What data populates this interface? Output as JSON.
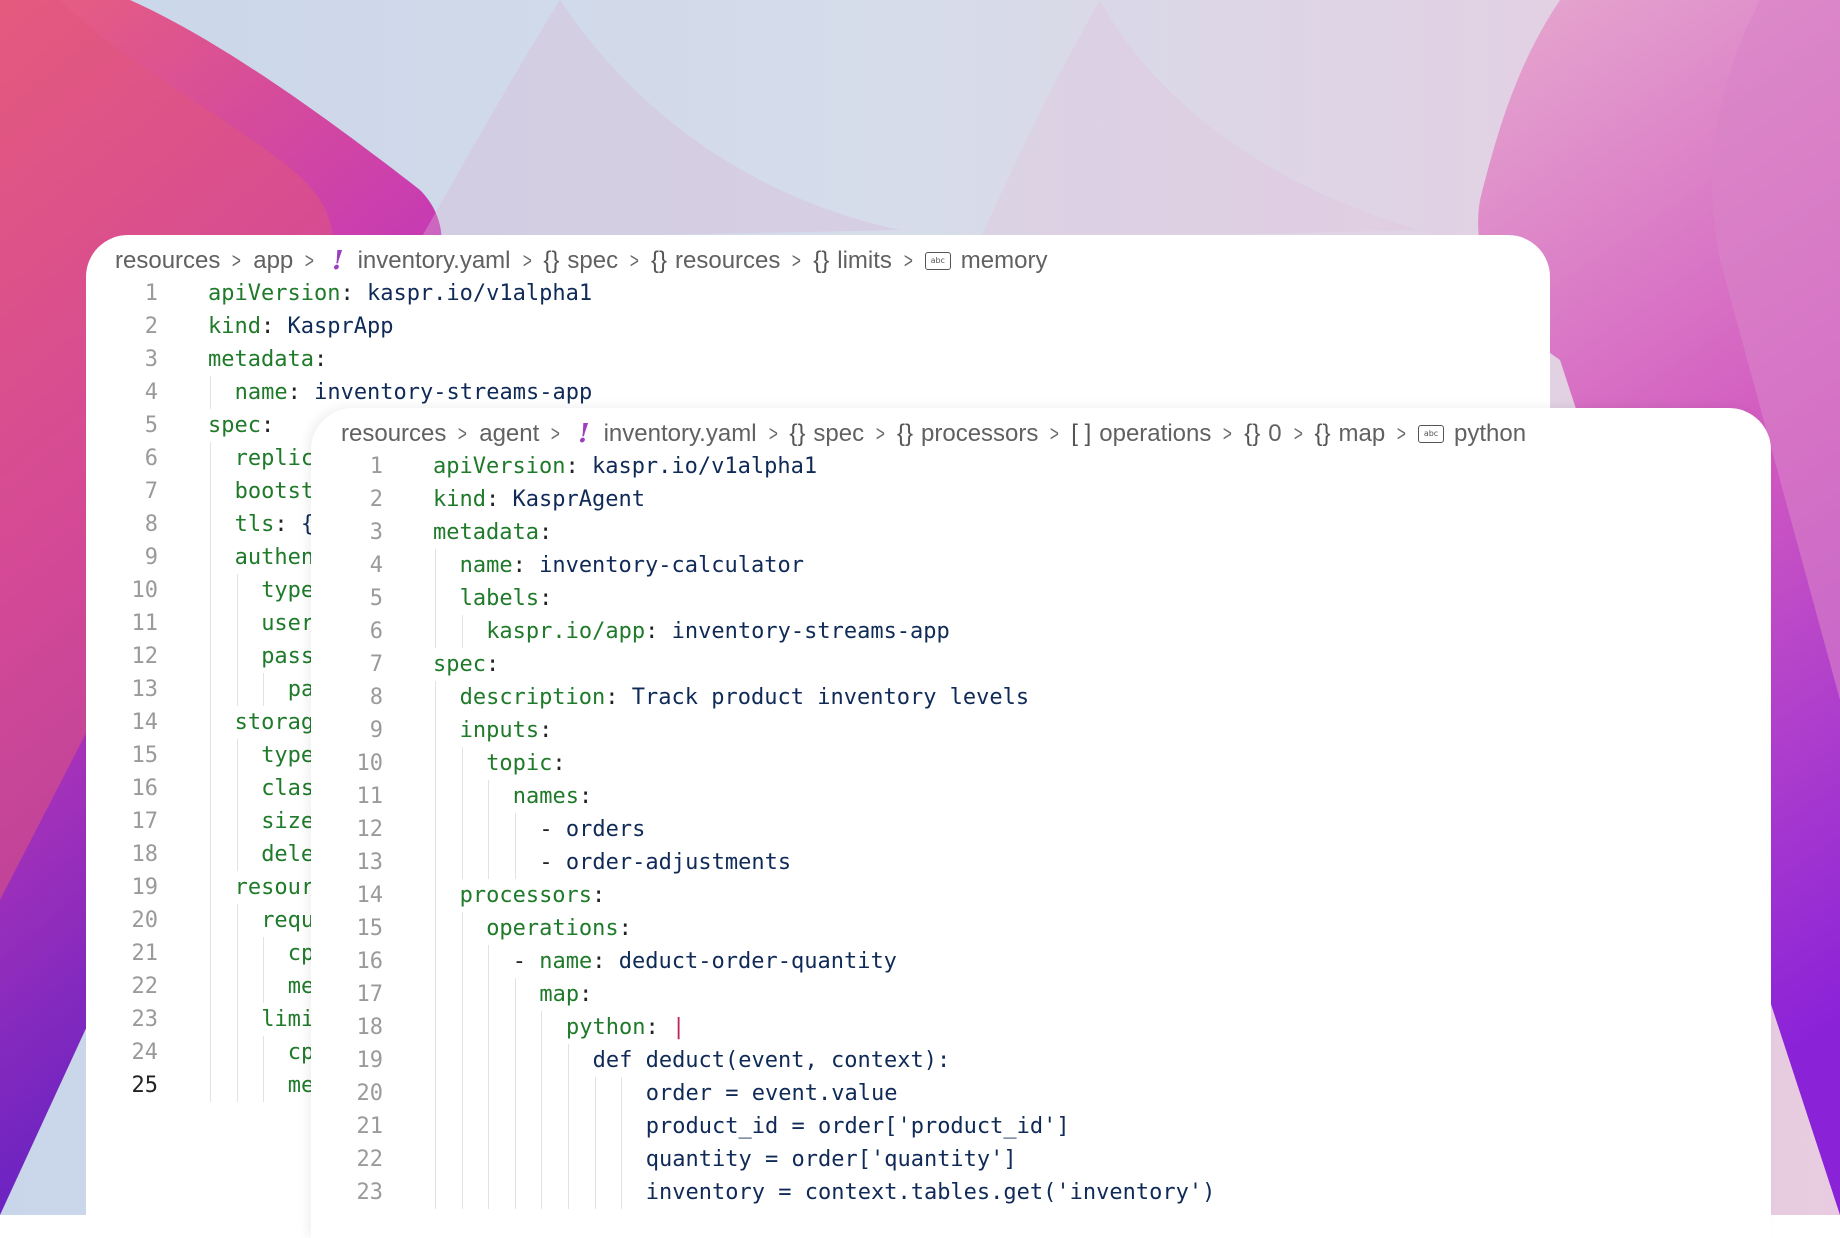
{
  "background": {
    "colors": [
      "#e3547a",
      "#b43bb8",
      "#6a1fc7",
      "#dcc8e6",
      "#c8d8ea"
    ]
  },
  "editor_back": {
    "breadcrumb": [
      {
        "icon": "",
        "label": "resources"
      },
      {
        "icon": "",
        "label": "app"
      },
      {
        "icon": "yaml-file-icon",
        "label": "inventory.yaml"
      },
      {
        "icon": "object-icon",
        "label": "spec"
      },
      {
        "icon": "object-icon",
        "label": "resources"
      },
      {
        "icon": "object-icon",
        "label": "limits"
      },
      {
        "icon": "string-icon",
        "label": "memory"
      }
    ],
    "active_line": 25,
    "lines": [
      {
        "n": 1,
        "indent": 0,
        "key": "apiVersion",
        "value": "kaspr.io/v1alpha1"
      },
      {
        "n": 2,
        "indent": 0,
        "key": "kind",
        "value": "KasprApp"
      },
      {
        "n": 3,
        "indent": 0,
        "key": "metadata",
        "value": ""
      },
      {
        "n": 4,
        "indent": 1,
        "key": "name",
        "value": "inventory-streams-app"
      },
      {
        "n": 5,
        "indent": 0,
        "key": "spec",
        "value": ""
      },
      {
        "n": 6,
        "indent": 1,
        "key": "replic",
        "value": ""
      },
      {
        "n": 7,
        "indent": 1,
        "key": "bootst",
        "value": ""
      },
      {
        "n": 8,
        "indent": 1,
        "key": "tls",
        "value": "{"
      },
      {
        "n": 9,
        "indent": 1,
        "key": "authen",
        "value": ""
      },
      {
        "n": 10,
        "indent": 2,
        "key": "type",
        "value": ""
      },
      {
        "n": 11,
        "indent": 2,
        "key": "user",
        "value": ""
      },
      {
        "n": 12,
        "indent": 2,
        "key": "pass",
        "value": ""
      },
      {
        "n": 13,
        "indent": 3,
        "key": "pa",
        "value": ""
      },
      {
        "n": 14,
        "indent": 1,
        "key": "storag",
        "value": ""
      },
      {
        "n": 15,
        "indent": 2,
        "key": "type",
        "value": ""
      },
      {
        "n": 16,
        "indent": 2,
        "key": "clas",
        "value": ""
      },
      {
        "n": 17,
        "indent": 2,
        "key": "size",
        "value": ""
      },
      {
        "n": 18,
        "indent": 2,
        "key": "dele",
        "value": ""
      },
      {
        "n": 19,
        "indent": 1,
        "key": "resour",
        "value": ""
      },
      {
        "n": 20,
        "indent": 2,
        "key": "requ",
        "value": ""
      },
      {
        "n": 21,
        "indent": 3,
        "key": "cp",
        "value": ""
      },
      {
        "n": 22,
        "indent": 3,
        "key": "me",
        "value": ""
      },
      {
        "n": 23,
        "indent": 2,
        "key": "limi",
        "value": ""
      },
      {
        "n": 24,
        "indent": 3,
        "key": "cp",
        "value": ""
      },
      {
        "n": 25,
        "indent": 3,
        "key": "me",
        "value": ""
      }
    ]
  },
  "editor_front": {
    "breadcrumb": [
      {
        "icon": "",
        "label": "resources"
      },
      {
        "icon": "",
        "label": "agent"
      },
      {
        "icon": "yaml-file-icon",
        "label": "inventory.yaml"
      },
      {
        "icon": "object-icon",
        "label": "spec"
      },
      {
        "icon": "object-icon",
        "label": "processors"
      },
      {
        "icon": "array-icon",
        "label": "operations"
      },
      {
        "icon": "object-icon",
        "label": "0"
      },
      {
        "icon": "object-icon",
        "label": "map"
      },
      {
        "icon": "string-icon",
        "label": "python"
      }
    ],
    "lines": [
      {
        "n": 1,
        "indent": 0,
        "key": "apiVersion",
        "value": "kaspr.io/v1alpha1"
      },
      {
        "n": 2,
        "indent": 0,
        "key": "kind",
        "value": "KasprAgent"
      },
      {
        "n": 3,
        "indent": 0,
        "key": "metadata",
        "value": ""
      },
      {
        "n": 4,
        "indent": 1,
        "key": "name",
        "value": "inventory-calculator"
      },
      {
        "n": 5,
        "indent": 1,
        "key": "labels",
        "value": ""
      },
      {
        "n": 6,
        "indent": 2,
        "key": "kaspr.io/app",
        "value": "inventory-streams-app"
      },
      {
        "n": 7,
        "indent": 0,
        "key": "spec",
        "value": ""
      },
      {
        "n": 8,
        "indent": 1,
        "key": "description",
        "value": "Track product inventory levels"
      },
      {
        "n": 9,
        "indent": 1,
        "key": "inputs",
        "value": ""
      },
      {
        "n": 10,
        "indent": 2,
        "key": "topic",
        "value": ""
      },
      {
        "n": 11,
        "indent": 3,
        "key": "names",
        "value": ""
      },
      {
        "n": 12,
        "indent": 4,
        "dash": true,
        "value": "orders"
      },
      {
        "n": 13,
        "indent": 4,
        "dash": true,
        "value": "order-adjustments"
      },
      {
        "n": 14,
        "indent": 1,
        "key": "processors",
        "value": ""
      },
      {
        "n": 15,
        "indent": 2,
        "key": "operations",
        "value": ""
      },
      {
        "n": 16,
        "indent": 3,
        "dash": true,
        "key": "name",
        "value": "deduct-order-quantity"
      },
      {
        "n": 17,
        "indent": 4,
        "key": "map",
        "value": ""
      },
      {
        "n": 18,
        "indent": 5,
        "key": "python",
        "value": "|",
        "block": true
      },
      {
        "n": 19,
        "indent": 6,
        "code": "def deduct(event, context):"
      },
      {
        "n": 20,
        "indent": 8,
        "code": "order = event.value"
      },
      {
        "n": 21,
        "indent": 8,
        "code": "product_id = order['product_id']"
      },
      {
        "n": 22,
        "indent": 8,
        "code": "quantity = order['quantity']"
      },
      {
        "n": 23,
        "indent": 8,
        "code": "inventory = context.tables.get('inventory')"
      }
    ]
  }
}
